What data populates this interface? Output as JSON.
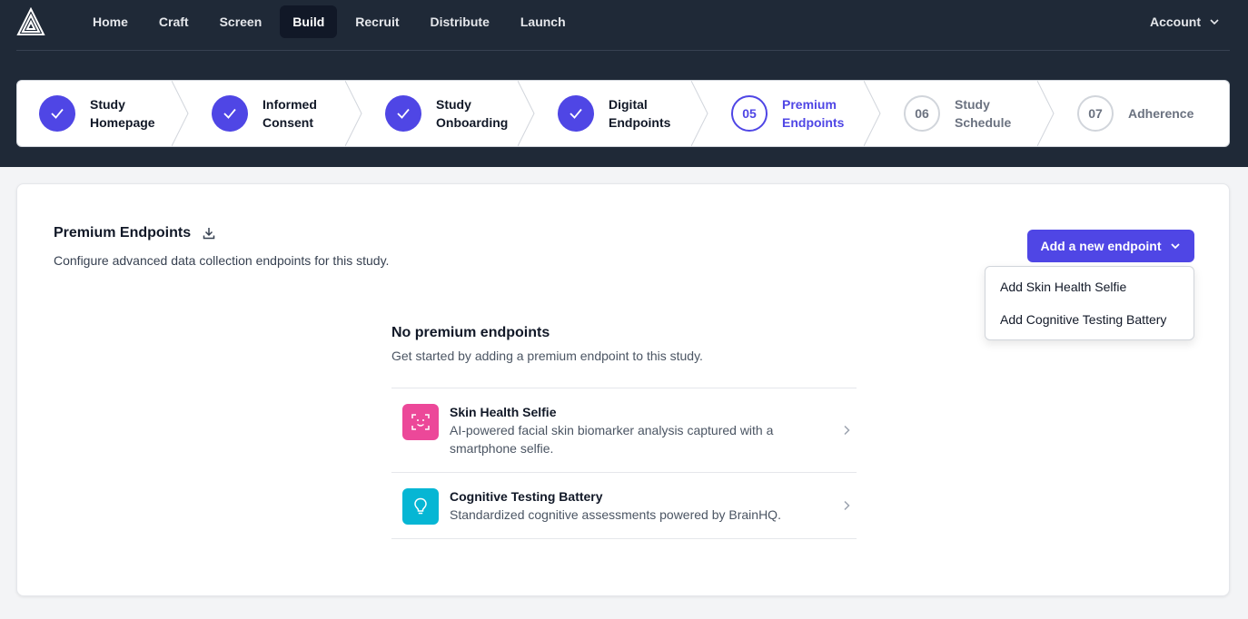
{
  "nav": {
    "logo_icon": "triangle-logo-icon",
    "items": [
      {
        "label": "Home"
      },
      {
        "label": "Craft"
      },
      {
        "label": "Screen"
      },
      {
        "label": "Build",
        "active": true
      },
      {
        "label": "Recruit"
      },
      {
        "label": "Distribute"
      },
      {
        "label": "Launch"
      }
    ],
    "account_label": "Account"
  },
  "stepper": {
    "steps": [
      {
        "line1": "Study",
        "line2": "Homepage",
        "state": "done"
      },
      {
        "line1": "Informed",
        "line2": "Consent",
        "state": "done"
      },
      {
        "line1": "Study",
        "line2": "Onboarding",
        "state": "done"
      },
      {
        "line1": "Digital",
        "line2": "Endpoints",
        "state": "done"
      },
      {
        "number": "05",
        "line1": "Premium",
        "line2": "Endpoints",
        "state": "current"
      },
      {
        "number": "06",
        "line1": "Study",
        "line2": "Schedule",
        "state": "todo"
      },
      {
        "number": "07",
        "line1": "Adherence",
        "line2": "",
        "state": "todo"
      }
    ]
  },
  "page": {
    "title": "Premium Endpoints",
    "subtitle": "Configure advanced data collection endpoints for this study.",
    "add_button_label": "Add a new endpoint",
    "dropdown": [
      {
        "label": "Add Skin Health Selfie"
      },
      {
        "label": "Add Cognitive Testing Battery"
      }
    ],
    "empty_title": "No premium endpoints",
    "empty_subtitle": "Get started by adding a premium endpoint to this study.",
    "endpoints": [
      {
        "name": "Skin Health Selfie",
        "description": "AI-powered facial skin biomarker analysis captured with a smartphone selfie.",
        "icon": "face-scan-icon",
        "color": "#ec4899"
      },
      {
        "name": "Cognitive Testing Battery",
        "description": "Standardized cognitive assessments powered by BrainHQ.",
        "icon": "lightbulb-icon",
        "color": "#06b6d4"
      }
    ]
  },
  "colors": {
    "accent": "#4f46e5",
    "nav_bg": "#1f2937"
  }
}
